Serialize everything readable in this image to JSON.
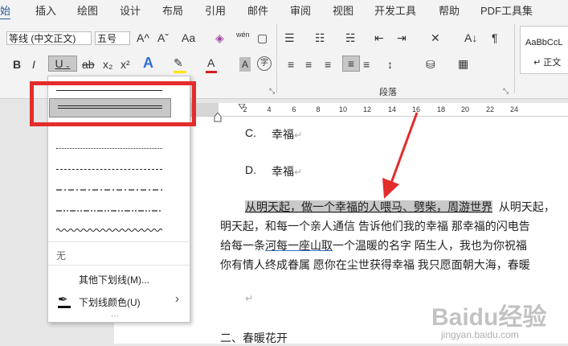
{
  "tabs": [
    "开始",
    "插入",
    "绘图",
    "设计",
    "布局",
    "引用",
    "邮件",
    "审阅",
    "视图",
    "开发工具",
    "帮助",
    "PDF工具集"
  ],
  "font": {
    "name": "等线 (中文正文)",
    "size": "五号"
  },
  "ribbon": {
    "paragraph_group_label": "段落",
    "style_preview": "AaBbCcL",
    "style_name": "↵ 正文",
    "buttons": {
      "bold": "B",
      "italic": "I",
      "underline": "U",
      "strike": "ab",
      "subscript": "x₂",
      "superscript": "x²",
      "grow": "A^",
      "shrink": "Aˇ",
      "case": "Aa",
      "wen": "wén",
      "text_effect": "A",
      "font_color": "A",
      "char_shade": "A",
      "enclose": "字",
      "sort": "A↓",
      "show_marks": "¶"
    }
  },
  "colors": {
    "accent": "#2b579a",
    "red_highlight": "#e42c2c",
    "font_color_bar": "#d81e1e",
    "highlighter_bar": "#ffe600"
  },
  "ruler": {
    "ticks": [
      "2",
      "4",
      "6",
      "8",
      "10",
      "12",
      "14",
      "16",
      "18",
      "20",
      "22",
      "24"
    ]
  },
  "document": {
    "option_c": "C.",
    "option_c_text": "幸福",
    "option_d": "D.",
    "option_d_text": "幸福",
    "para_line1_highlighted": "从明天起，做一个幸福的人喂马、劈柴，周游世界",
    "para_line1_rest": "从明天起，",
    "para_line2": "明天起，和每一个亲人通信  告诉他们我的幸福  那幸福的闪电告",
    "para_line3_a": "给每一条",
    "para_line3_ul": "河每一座山取",
    "para_line3_b": "一个温暖的名字  陌生人，我也为你祝福",
    "para_line4": "你有情人终成眷属  愿你在尘世获得幸福  我只愿面朝大海，春暖",
    "empty_para": "↵",
    "heading": "二、春暖花开",
    "para_mark": "↵"
  },
  "underline_menu": {
    "none_label": "无",
    "more_label": "其他下划线(M)...",
    "color_label": "下划线颜色(U)",
    "more_arrow": "›"
  },
  "watermark": {
    "text": "Baidu经验",
    "sub": "jingyan.baidu.com"
  }
}
